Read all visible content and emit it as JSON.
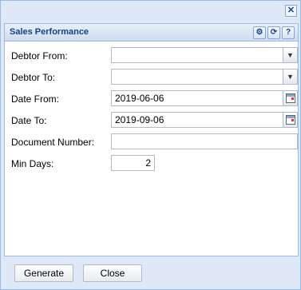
{
  "window": {
    "close_symbol": "✕"
  },
  "panel": {
    "title": "Sales Performance",
    "tools": [
      {
        "icon": "gear-icon",
        "glyph": "⚙"
      },
      {
        "icon": "refresh-icon",
        "glyph": "⟳"
      },
      {
        "icon": "help-icon",
        "glyph": "?"
      }
    ]
  },
  "form": {
    "debtor_from": {
      "label": "Debtor From:",
      "value": ""
    },
    "debtor_to": {
      "label": "Debtor To:",
      "value": ""
    },
    "date_from": {
      "label": "Date From:",
      "value": "2019-06-06"
    },
    "date_to": {
      "label": "Date To:",
      "value": "2019-09-06"
    },
    "document_number": {
      "label": "Document Number:",
      "value": ""
    },
    "min_days": {
      "label": "Min Days:",
      "value": "2"
    }
  },
  "buttons": {
    "generate": "Generate",
    "close": "Close"
  },
  "dropdown_arrow": "▼"
}
